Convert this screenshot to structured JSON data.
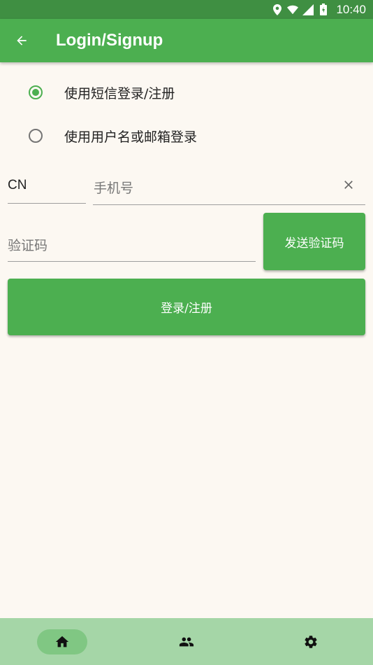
{
  "status_bar": {
    "time": "10:40",
    "icons": [
      "location-icon",
      "wifi-icon",
      "signal-icon",
      "battery-icon"
    ]
  },
  "app_bar": {
    "title": "Login/Signup",
    "back_icon": "arrow-back-icon",
    "color": "#4caf50"
  },
  "login_mode": {
    "options": [
      {
        "label": "使用短信登录/注册",
        "selected": true
      },
      {
        "label": "使用用户名或邮箱登录",
        "selected": false
      }
    ]
  },
  "form": {
    "country_code": "CN",
    "phone_placeholder": "手机号",
    "code_placeholder": "验证码",
    "send_code_label": "发送验证码",
    "submit_label": "登录/注册"
  },
  "bottom_nav": {
    "items": [
      {
        "icon": "home-icon",
        "active": true
      },
      {
        "icon": "people-icon",
        "active": false
      },
      {
        "icon": "settings-icon",
        "active": false
      }
    ]
  },
  "colors": {
    "primary": "#4caf50",
    "status_bar": "#3f8f42",
    "background": "#fcf8f2",
    "bottom_nav": "#a5d6a7"
  }
}
